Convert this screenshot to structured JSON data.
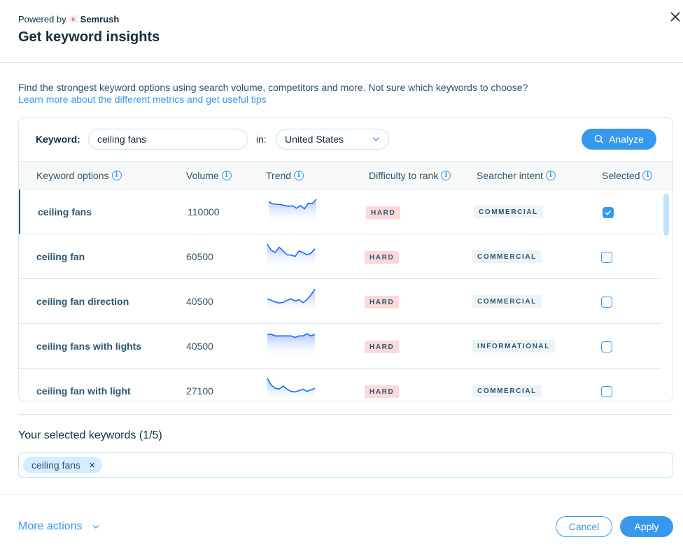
{
  "header": {
    "powered_by": "Powered by",
    "brand": "Semrush",
    "title": "Get keyword insights",
    "close_icon": "close-icon"
  },
  "intro": {
    "description": "Find the strongest keyword options using search volume, competitors and more. Not sure which keywords to choose?",
    "learn_link": "Learn more about the different metrics and get useful tips"
  },
  "search": {
    "keyword_label": "Keyword:",
    "keyword_value": "ceiling fans",
    "in_label": "in:",
    "country": "United States",
    "analyze_label": "Analyze"
  },
  "table": {
    "columns": [
      {
        "label": "Keyword options"
      },
      {
        "label": "Volume"
      },
      {
        "label": "Trend"
      },
      {
        "label": "Difficulty to rank"
      },
      {
        "label": "Searcher intent"
      },
      {
        "label": "Selected"
      }
    ],
    "rows": [
      {
        "keyword": "ceiling fans",
        "volume": "110000",
        "difficulty": "HARD",
        "intent": "COMMERCIAL",
        "selected": true,
        "trend": [
          0.85,
          0.7,
          0.68,
          0.66,
          0.6,
          0.55,
          0.58,
          0.42,
          0.6,
          0.38,
          0.75,
          0.72,
          1.0
        ]
      },
      {
        "keyword": "ceiling fan",
        "volume": "60500",
        "difficulty": "HARD",
        "intent": "COMMERCIAL",
        "selected": false,
        "trend": [
          1.0,
          0.6,
          0.45,
          0.8,
          0.55,
          0.3,
          0.28,
          0.2,
          0.55,
          0.45,
          0.3,
          0.4,
          0.7
        ]
      },
      {
        "keyword": "ceiling fan direction",
        "volume": "40500",
        "difficulty": "HARD",
        "intent": "COMMERCIAL",
        "selected": false,
        "trend": [
          0.35,
          0.25,
          0.15,
          0.08,
          0.12,
          0.25,
          0.35,
          0.2,
          0.3,
          0.1,
          0.3,
          0.6,
          1.0
        ]
      },
      {
        "keyword": "ceiling fans with lights",
        "volume": "40500",
        "difficulty": "HARD",
        "intent": "INFORMATIONAL",
        "selected": false,
        "trend": [
          0.95,
          0.95,
          0.85,
          0.85,
          0.85,
          0.85,
          0.85,
          0.75,
          0.85,
          0.85,
          1.0,
          0.85,
          0.95
        ]
      },
      {
        "keyword": "ceiling fan with light",
        "volume": "27100",
        "difficulty": "HARD",
        "intent": "COMMERCIAL",
        "selected": false,
        "trend": [
          1.0,
          0.55,
          0.35,
          0.32,
          0.5,
          0.3,
          0.15,
          0.12,
          0.2,
          0.3,
          0.15,
          0.25,
          0.35
        ]
      }
    ]
  },
  "selected": {
    "title": "Your selected keywords (1/5)",
    "tags": [
      "ceiling fans"
    ]
  },
  "footer": {
    "more_actions": "More actions",
    "cancel": "Cancel",
    "apply": "Apply"
  },
  "colors": {
    "accent": "#3899ec",
    "hard_badge": "#fdd8d8",
    "intent_badge": "#eef3f6",
    "text_dark": "#162d3d"
  }
}
